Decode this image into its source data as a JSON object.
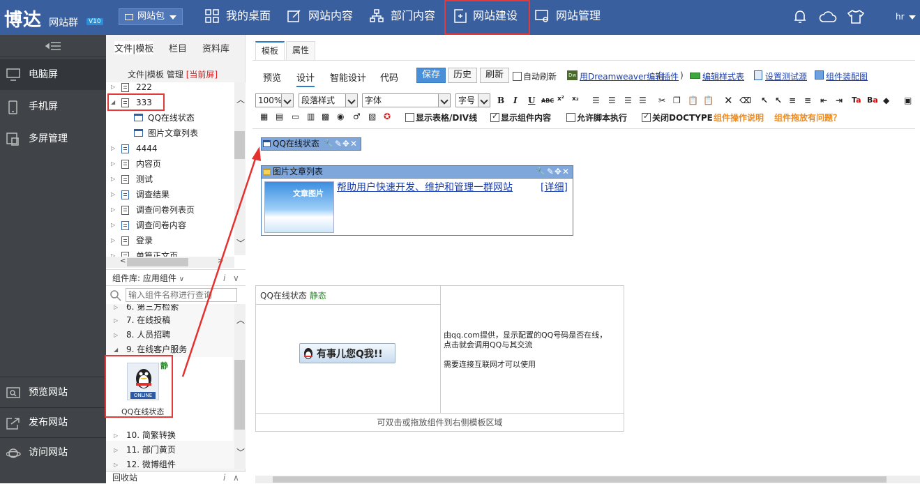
{
  "topbar": {
    "logo": "博达",
    "logo_sub": "网站群",
    "version": "V10",
    "package_label": "网站包",
    "nav": [
      {
        "label": "我的桌面"
      },
      {
        "label": "网站内容"
      },
      {
        "label": "部门内容"
      },
      {
        "label": "网站建设"
      },
      {
        "label": "网站管理"
      }
    ],
    "user": "hr"
  },
  "sidebar": {
    "items": [
      {
        "label": "电脑屏"
      },
      {
        "label": "手机屏"
      },
      {
        "label": "多屏管理"
      }
    ],
    "bottom": [
      {
        "label": "预览网站"
      },
      {
        "label": "发布网站"
      },
      {
        "label": "访问网站"
      }
    ]
  },
  "left_panel": {
    "tabs": [
      "文件|模板",
      "栏目",
      "资料库"
    ],
    "subtitle": "文件|模板 管理",
    "current": "[当前屏]",
    "tree": [
      {
        "label": "222"
      },
      {
        "label": "333"
      },
      {
        "label": "QQ在线状态"
      },
      {
        "label": "图片文章列表"
      },
      {
        "label": "4444"
      },
      {
        "label": "内容页"
      },
      {
        "label": "测试"
      },
      {
        "label": "调查结果"
      },
      {
        "label": "调查问卷列表页"
      },
      {
        "label": "调查问卷内容"
      },
      {
        "label": "登录"
      },
      {
        "label": "单篇正文页"
      }
    ],
    "component_header": "组件库: 应用组件",
    "search_placeholder": "输入组件名称进行查询",
    "components_top": [
      {
        "label": "6.  第三方检索"
      },
      {
        "label": "7.  在线投稿"
      },
      {
        "label": "8.  人员招聘"
      },
      {
        "label": "9.  在线客户服务"
      }
    ],
    "qq_component": {
      "label": "QQ在线状态",
      "badge": "静",
      "online": "ONLINE"
    },
    "components_bottom": [
      {
        "label": "10.  简繁转换"
      },
      {
        "label": "11.  部门黄页"
      },
      {
        "label": "12.  微博组件"
      }
    ],
    "recycle": "回收站"
  },
  "main": {
    "tabs": [
      "模板",
      "属性"
    ],
    "modes": [
      "预览",
      "设计",
      "智能设计",
      "代码"
    ],
    "buttons": {
      "save": "保存",
      "history": "历史",
      "refresh": "刷新"
    },
    "auto_refresh": "自动刷新",
    "dw_link": "用Dreamweaver编辑",
    "plugin_link": "插件",
    "edit_style": "编辑样式表",
    "set_test_source": "设置测试源",
    "assemble_map": "组件装配图",
    "zoom": "100%",
    "paragraph": "段落样式",
    "font": "字体",
    "font_size": "字号",
    "show_table": "显示表格/DIV线",
    "show_component": "显示组件内容",
    "allow_script": "允许脚本执行",
    "close_doctype": "关闭DOCTYPE",
    "comp_help": "组件操作说明",
    "comp_drag_help": "组件拖放有问题？",
    "widget_qq": "QQ在线状态",
    "widget_img": "图片文章列表",
    "article_thumb": "文章图片",
    "article_title": "帮助用户快速开发、维护和管理一群网站",
    "article_more": "[详细]",
    "info_title": "QQ在线状态",
    "info_static": "静态",
    "qq_btn": "有事儿您Q我!!",
    "info_desc1": "由qq.com提供，显示配置的QQ号码是否在线，",
    "info_desc2": "点击就会调用QQ与其交流",
    "info_desc3": "需要连接互联网才可以使用",
    "info_footer": "可双击或拖放组件到右侧模板区域"
  },
  "colors": {
    "topbar": "#3a5f9e",
    "sidebar": "#404448",
    "highlight": "#e23a3a",
    "accent": "#4a90d9",
    "orange": "#f08a1a"
  }
}
